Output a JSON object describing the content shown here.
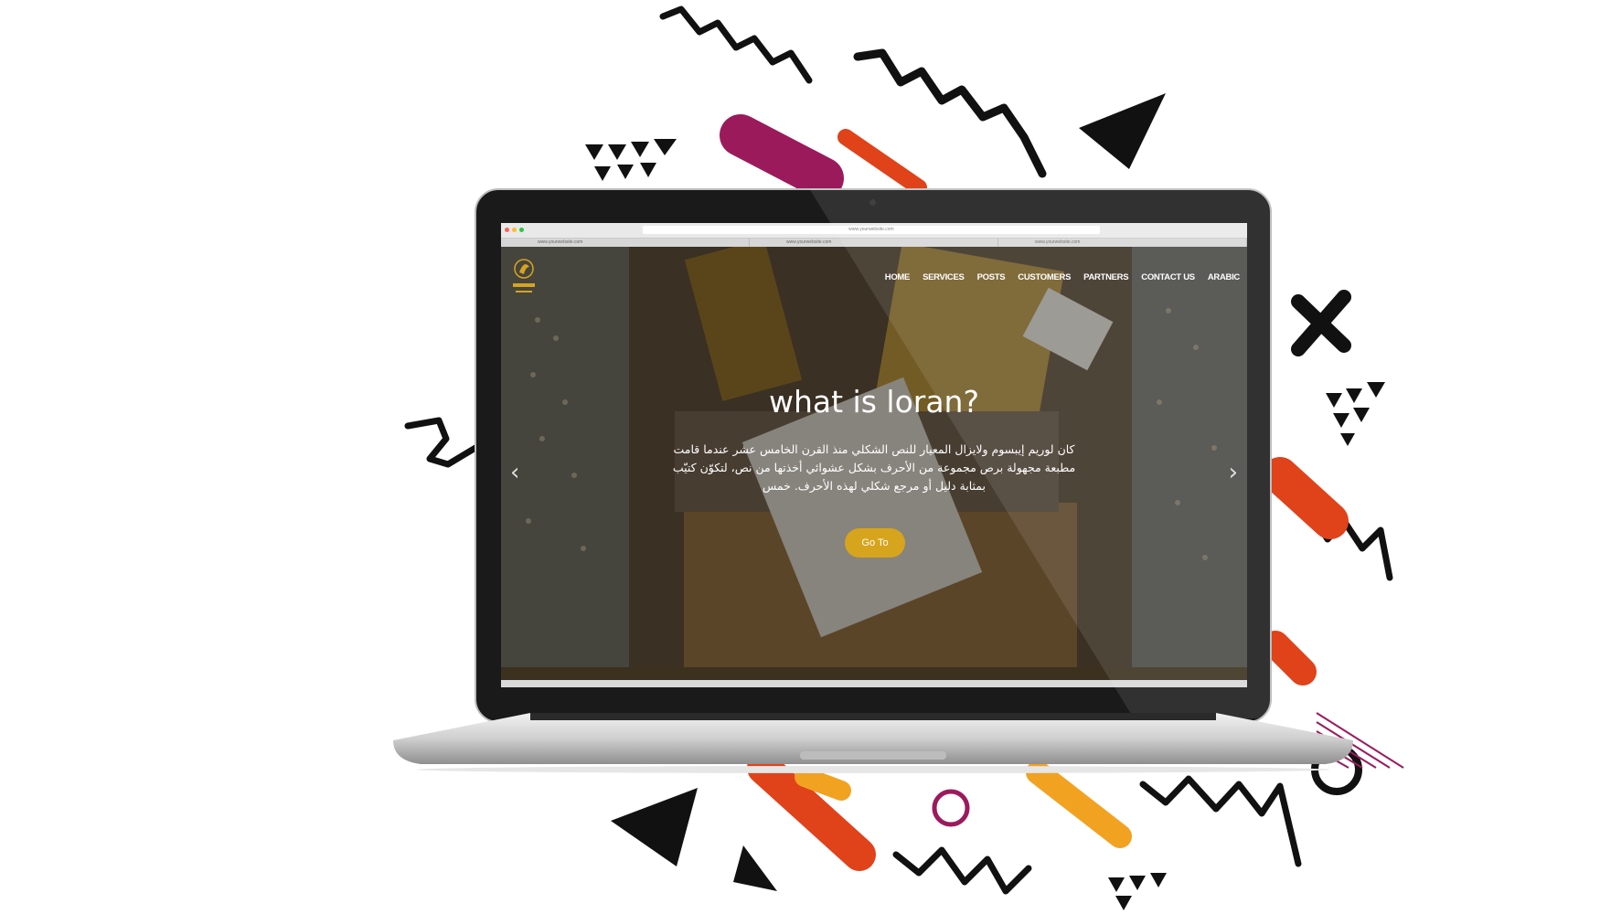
{
  "browser": {
    "url": "www.yourwebsite.com",
    "tabs": [
      "www.yourwebsite.com",
      "www.yourwebsite.com",
      "www.yourwebsite.com"
    ]
  },
  "nav": {
    "items": [
      "HOME",
      "SERVICES",
      "POSTS",
      "CUSTOMERS",
      "PARTNERS",
      "CONTACT US",
      "ARABIC"
    ]
  },
  "hero": {
    "title": "what is loran?",
    "description": "كان لوريم إيبسوم ولايزال المعيار للنص الشكلي منذ القرن الخامس عشر عندما قامت مطبعة مجهولة برص مجموعة من الأحرف بشكل عشوائي أخذتها من نص، لتكوّن كتيّب بمثابة دليل أو مرجع شكلي لهذه الأحرف. خمس",
    "button_label": "Go To",
    "prev_icon": "‹",
    "next_icon": "›"
  },
  "colors": {
    "accent": "#d7a41d",
    "magenta": "#9b1a5c",
    "orange_red": "#e0421a",
    "orange": "#f2a221",
    "black": "#111111"
  }
}
